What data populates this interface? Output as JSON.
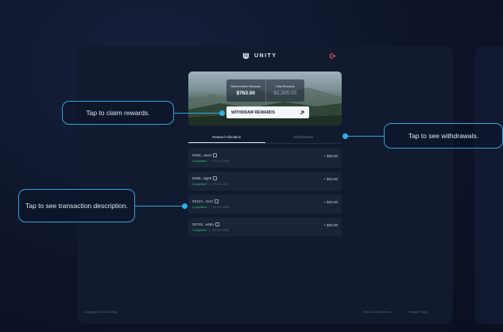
{
  "app": {
    "brand": "UNITY"
  },
  "rewards": {
    "redeemable_label": "Redeemable Rewards",
    "redeemable_value": "$763.00",
    "total_label": "Total Rewards",
    "total_value": "$2,335.00",
    "withdraw_label": "WITHDRAW REWARDS"
  },
  "tabs": [
    {
      "label": "Reward Allocation",
      "active": true
    },
    {
      "label": "Withdrawals",
      "active": false
    }
  ],
  "transactions": [
    {
      "address": "0X93...3ea4",
      "status": "Completed",
      "date": "20 Oct 2025",
      "amount": "+ $25.00"
    },
    {
      "address": "0X58...6ge0",
      "status": "Completed",
      "date": "19 Oct 2025",
      "amount": "+ $10.00"
    },
    {
      "address": "0X12A...9c1f",
      "status": "Completed",
      "date": "18 Oct 2025",
      "amount": "+ $10.00"
    },
    {
      "address": "0X745...a46a",
      "status": "Completed",
      "date": "30 Oct 2025",
      "amount": "+ $20.00"
    }
  ],
  "callouts": {
    "claim": "Tap to claim rewards.",
    "withdrawals": "Tap to see withdrawals.",
    "description": "Tap to see transaction description."
  },
  "footer": {
    "copyright": "Copyright © 2025 Unity",
    "terms": "Terms & Conditions",
    "privacy": "Privacy Policy"
  },
  "colors": {
    "accent": "#2fb1ec",
    "success": "#27c281",
    "panel": "#111a2e"
  }
}
